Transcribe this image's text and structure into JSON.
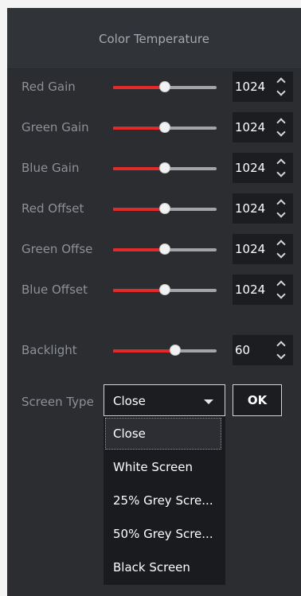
{
  "panel": {
    "title": "Color Temperature"
  },
  "controls": [
    {
      "label": "Red Gain",
      "value": "1024",
      "level": 0.5
    },
    {
      "label": "Green Gain",
      "value": "1024",
      "level": 0.5
    },
    {
      "label": "Blue Gain",
      "value": "1024",
      "level": 0.5
    },
    {
      "label": "Red Offset",
      "value": "1024",
      "level": 0.5
    },
    {
      "label": "Green Offse",
      "value": "1024",
      "level": 0.5
    },
    {
      "label": "Blue Offset",
      "value": "1024",
      "level": 0.5
    },
    {
      "label": "Backlight",
      "value": "60",
      "level": 0.6
    }
  ],
  "screen_type": {
    "label": "Screen Type",
    "selected": "Close",
    "ok_label": "OK",
    "options": [
      "Close",
      "White Screen",
      "25% Grey Scre...",
      "50% Grey Scre...",
      "Black Screen"
    ]
  },
  "colors": {
    "slider_fill": "#e22a2a",
    "slider_track": "#a2a4a8",
    "panel_bg": "#2b2d31",
    "input_bg": "#1c1d20"
  }
}
